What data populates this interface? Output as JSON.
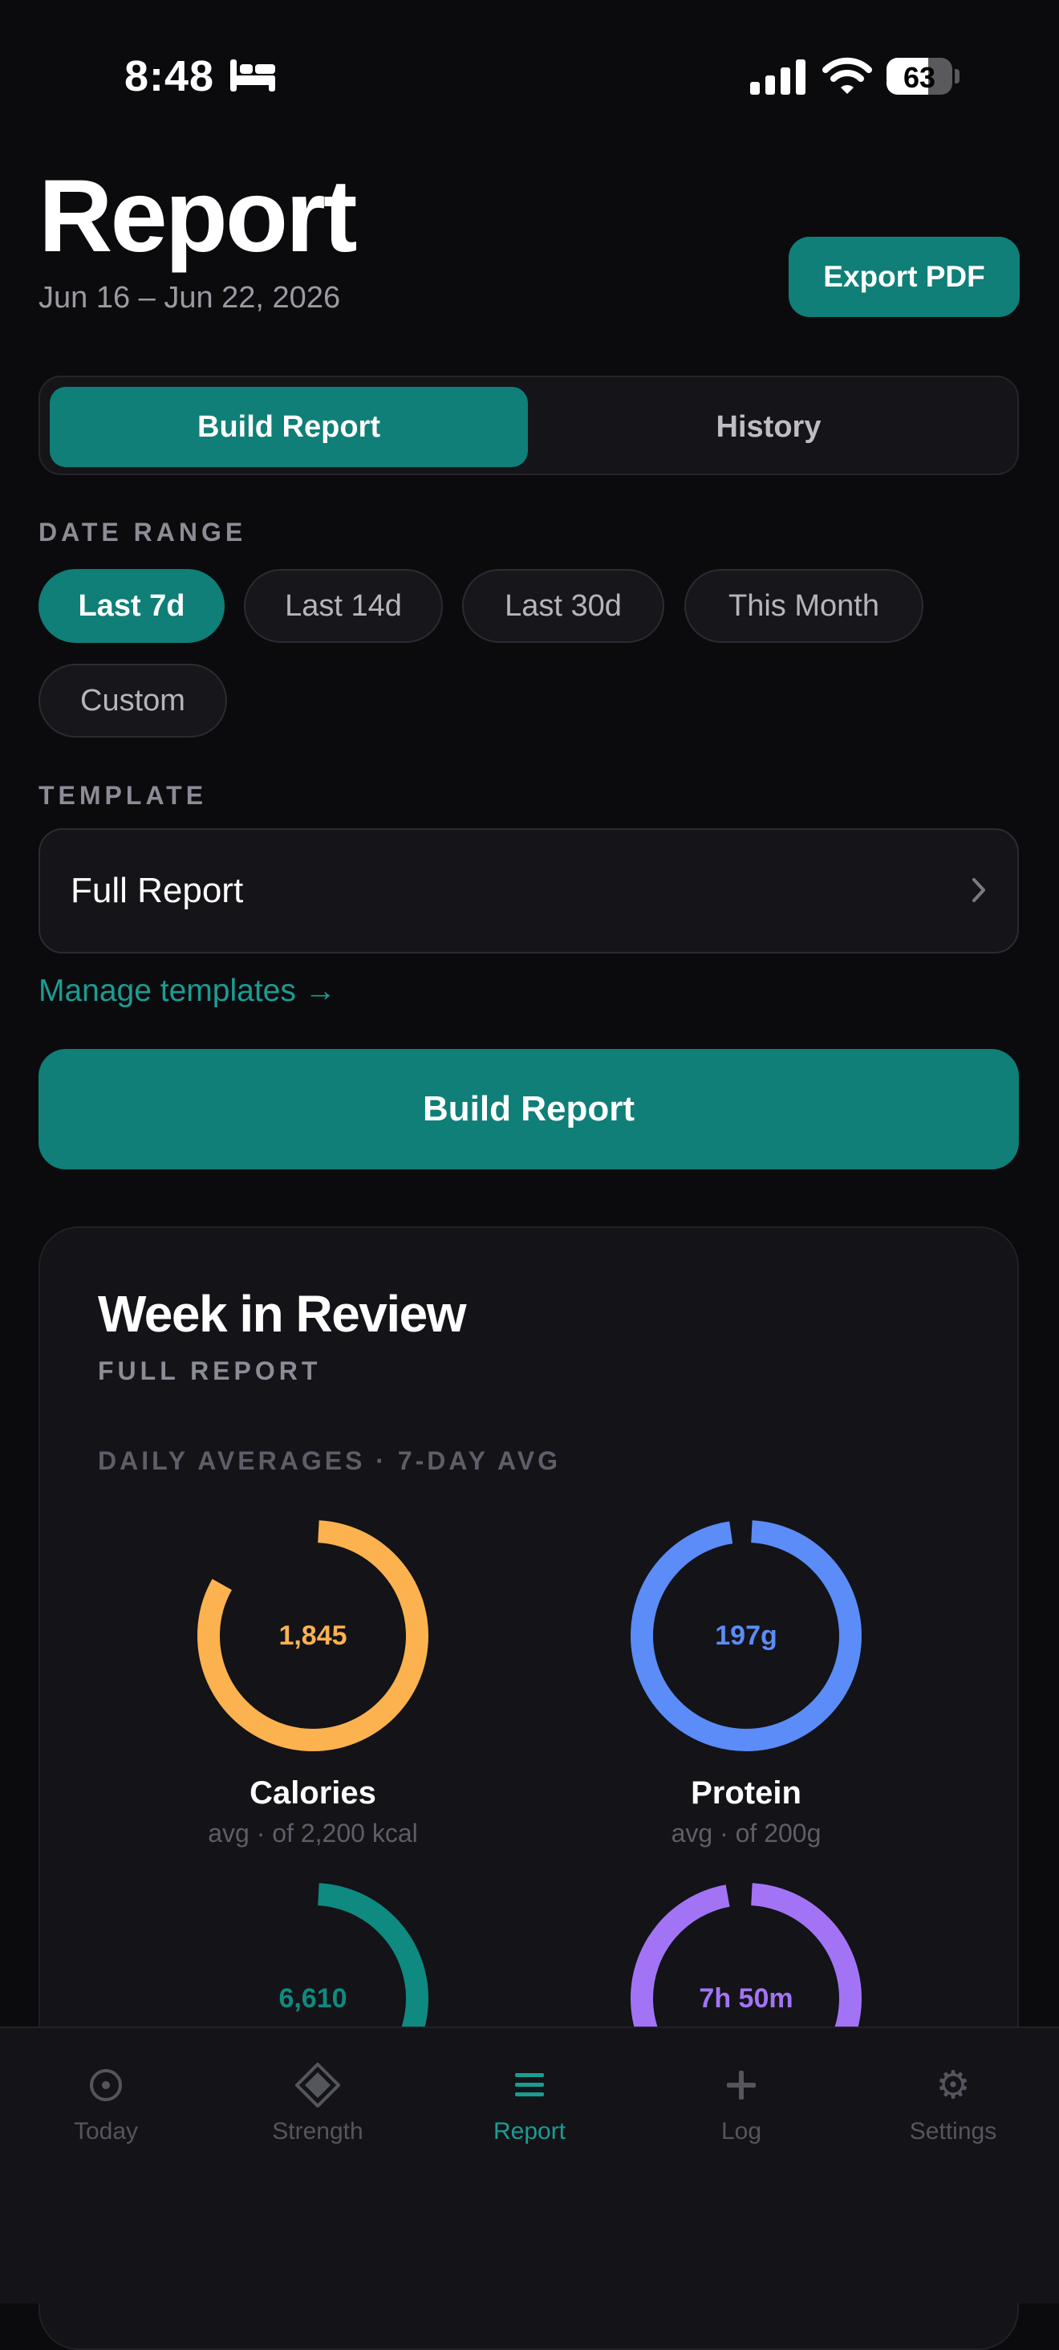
{
  "status_bar": {
    "time": "8:48",
    "battery": "63",
    "battery_level": 0.63
  },
  "header": {
    "title": "Report",
    "date_range": "Jun 16 – Jun 22, 2026",
    "export_label": "Export PDF"
  },
  "segmented": [
    {
      "label": "Build Report",
      "active": true
    },
    {
      "label": "History",
      "active": false
    }
  ],
  "date_range": {
    "label": "DATE RANGE",
    "chips": [
      {
        "label": "Last 7d",
        "active": true
      },
      {
        "label": "Last 14d",
        "active": false
      },
      {
        "label": "Last 30d",
        "active": false
      },
      {
        "label": "This Month",
        "active": false
      },
      {
        "label": "Custom",
        "active": false
      }
    ]
  },
  "template": {
    "label": "TEMPLATE",
    "value": "Full Report",
    "manage_link": "Manage templates →"
  },
  "build_button": "Build Report",
  "report": {
    "title": "Week in Review",
    "subtitle": "FULL REPORT",
    "section": "DAILY AVERAGES · 7-DAY AVG",
    "metrics": [
      {
        "name": "Calories",
        "value": "1,845",
        "sub": "avg · of 2,200 kcal",
        "color": "#fbb24f",
        "progress": 0.84
      },
      {
        "name": "Protein",
        "value": "197g",
        "sub": "avg · of 200g",
        "color": "#5b8cf7",
        "progress": 0.985
      },
      {
        "name": "",
        "value": "6,610",
        "sub": "",
        "color": "#0f8a80",
        "progress": 0.66
      },
      {
        "name": "",
        "value": "7h 50m",
        "sub": "",
        "color": "#a274f5",
        "progress": 0.98
      }
    ]
  },
  "tabs": [
    {
      "label": "Today",
      "icon": "target-icon",
      "active": false
    },
    {
      "label": "Strength",
      "icon": "diamond-icon",
      "active": false
    },
    {
      "label": "Report",
      "icon": "list-icon",
      "active": true
    },
    {
      "label": "Log",
      "icon": "plus-icon",
      "active": false
    },
    {
      "label": "Settings",
      "icon": "gear-icon",
      "active": false
    }
  ],
  "colors": {
    "accent": "#0f7f78",
    "accent_text": "#1a9d93",
    "background": "#0b0b0e",
    "card": "#131318"
  }
}
